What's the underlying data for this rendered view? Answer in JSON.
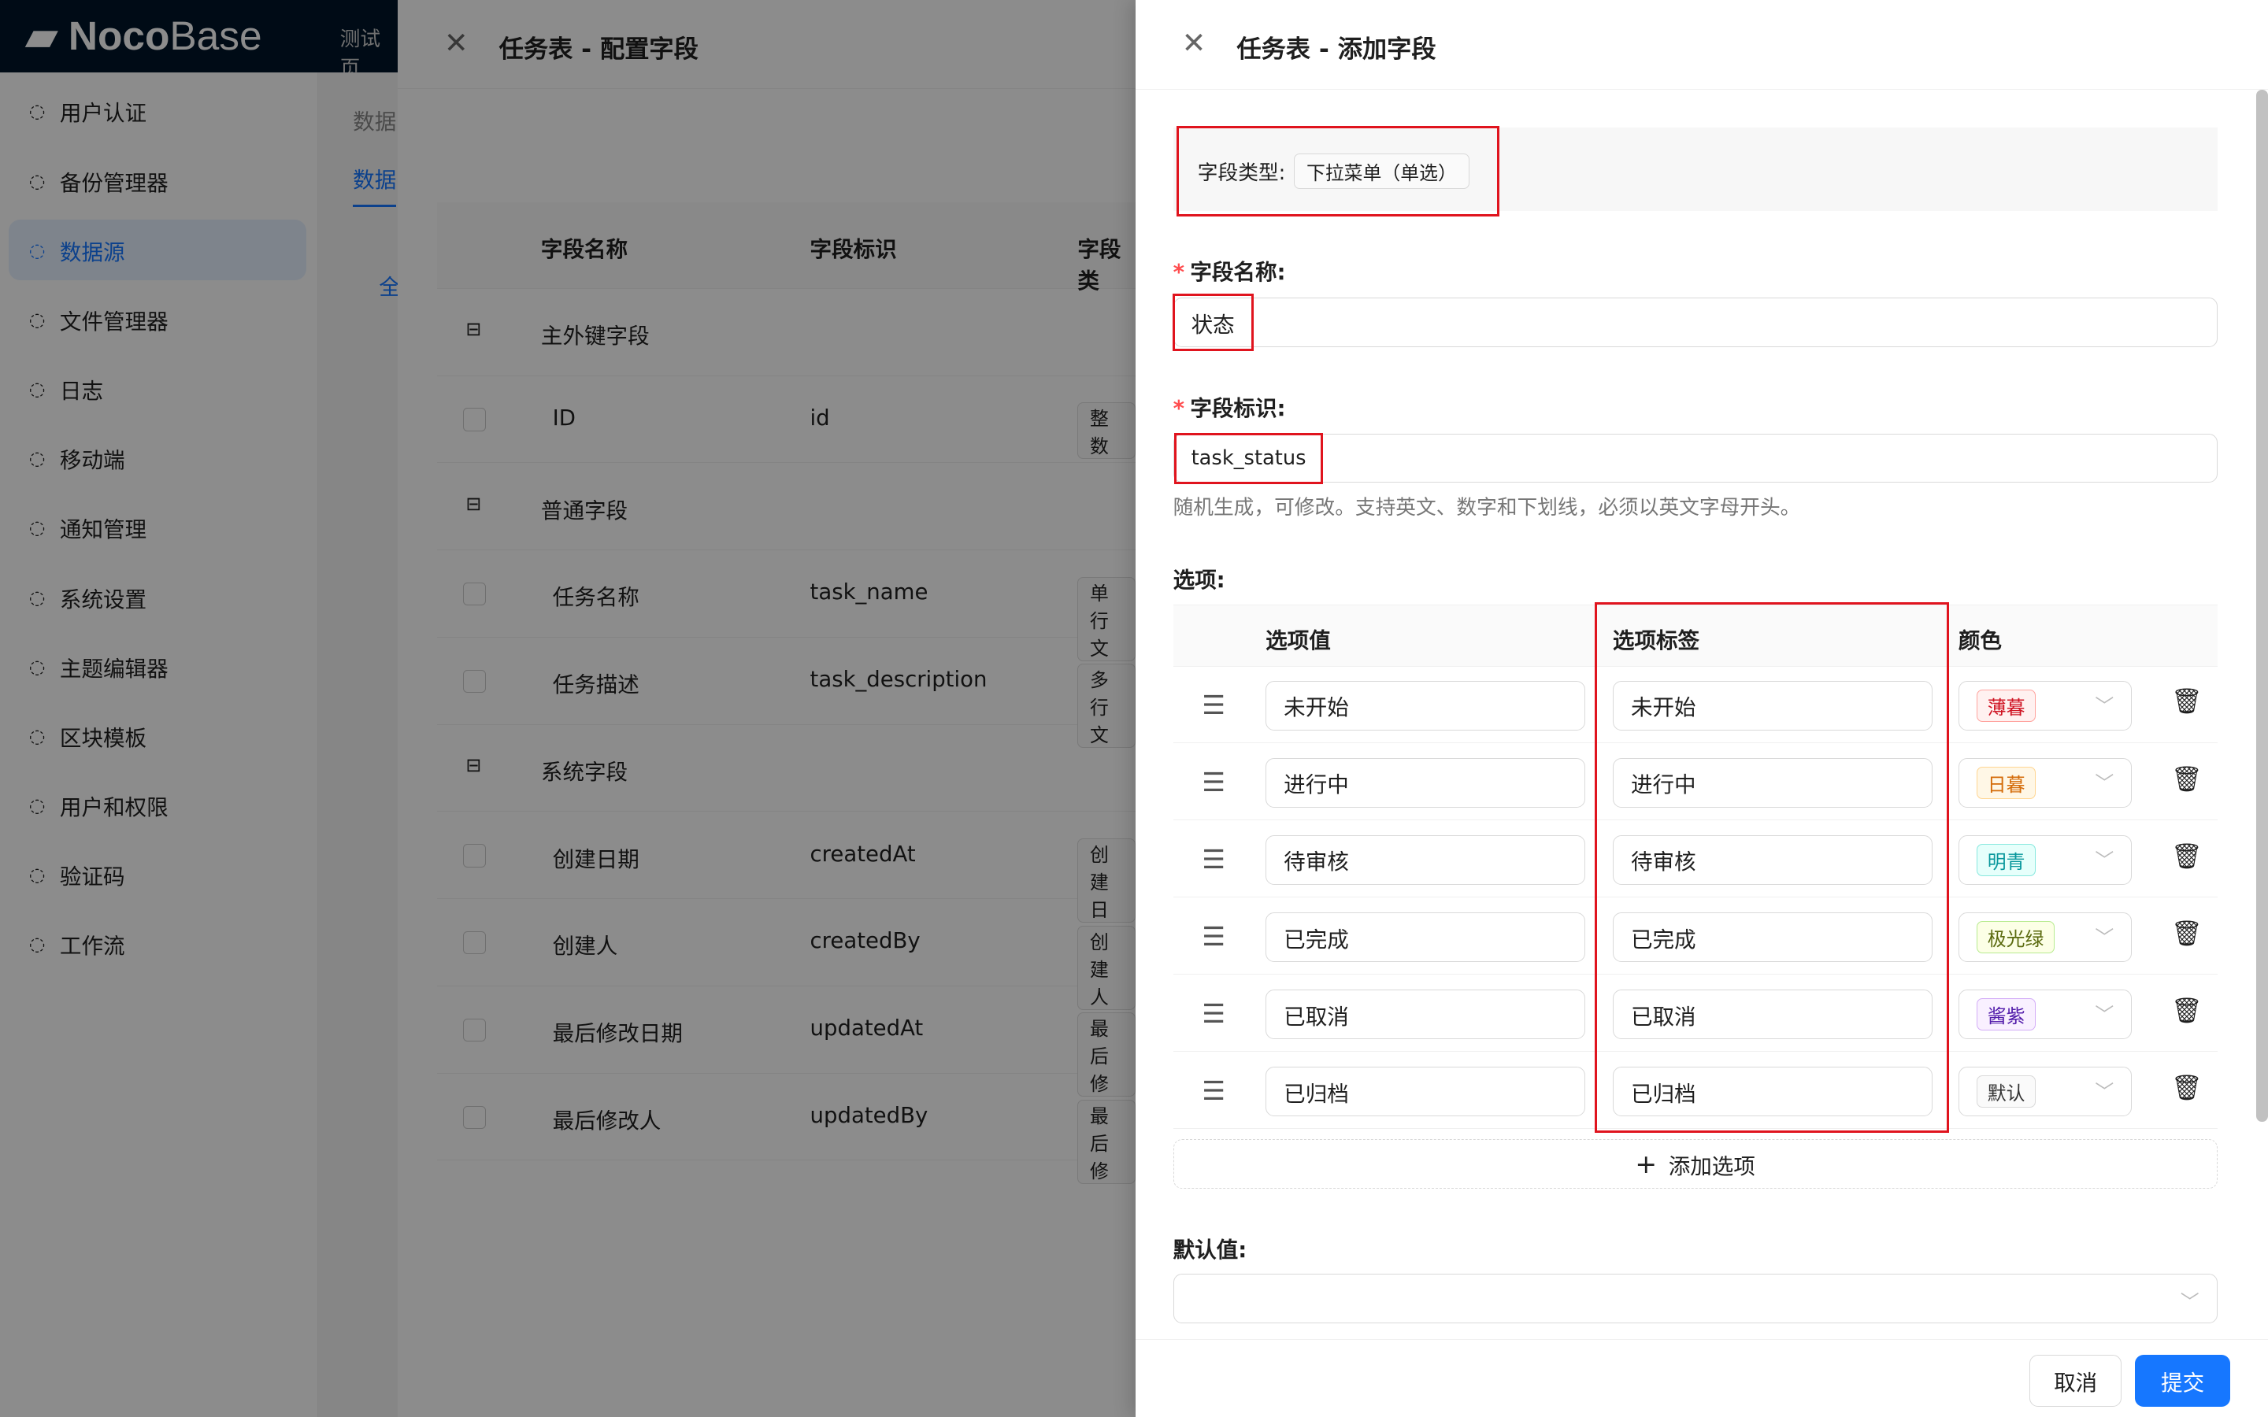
{
  "app": {
    "logo": "NocoBase",
    "top_tab": "测试页"
  },
  "sidebar": {
    "items": [
      {
        "label": "用户认证",
        "icon": "login-icon"
      },
      {
        "label": "备份管理器",
        "icon": "backup-icon"
      },
      {
        "label": "数据源",
        "icon": "database-icon",
        "active": true
      },
      {
        "label": "文件管理器",
        "icon": "file-icon"
      },
      {
        "label": "日志",
        "icon": "log-icon"
      },
      {
        "label": "移动端",
        "icon": "mobile-icon"
      },
      {
        "label": "通知管理",
        "icon": "notification-icon"
      },
      {
        "label": "系统设置",
        "icon": "gear-icon"
      },
      {
        "label": "主题编辑器",
        "icon": "theme-icon"
      },
      {
        "label": "区块模板",
        "icon": "template-icon"
      },
      {
        "label": "用户和权限",
        "icon": "user-icon"
      },
      {
        "label": "验证码",
        "icon": "captcha-icon"
      },
      {
        "label": "工作流",
        "icon": "workflow-icon"
      }
    ]
  },
  "bg_page": {
    "label1": "数据",
    "tab": "数据",
    "btn": "全"
  },
  "config_drawer": {
    "title": "任务表 - 配置字段",
    "headers": [
      "字段名称",
      "字段标识",
      "字段类"
    ],
    "rows": [
      {
        "group": true,
        "name": "主外键字段"
      },
      {
        "name": "ID",
        "key": "id",
        "type": "整数"
      },
      {
        "group": true,
        "name": "普通字段"
      },
      {
        "name": "任务名称",
        "key": "task_name",
        "type": "单行文"
      },
      {
        "name": "任务描述",
        "key": "task_description",
        "type": "多行文"
      },
      {
        "group": true,
        "name": "系统字段"
      },
      {
        "name": "创建日期",
        "key": "createdAt",
        "type": "创建日"
      },
      {
        "name": "创建人",
        "key": "createdBy",
        "type": "创建人"
      },
      {
        "name": "最后修改日期",
        "key": "updatedAt",
        "type": "最后修"
      },
      {
        "name": "最后修改人",
        "key": "updatedBy",
        "type": "最后修"
      }
    ]
  },
  "add_drawer": {
    "title": "任务表 - 添加字段",
    "field_type_label": "字段类型:",
    "field_type": "下拉菜单（单选）",
    "name_label": "字段名称:",
    "name_value": "状态",
    "key_label": "字段标识:",
    "key_value": "task_status",
    "key_hint": "随机生成，可修改。支持英文、数字和下划线，必须以英文字母开头。",
    "options_label": "选项:",
    "headers": {
      "value": "选项值",
      "label": "选项标签",
      "color": "颜色"
    },
    "options": [
      {
        "value": "未开始",
        "label": "未开始",
        "color": "薄暮",
        "fg": "#cf1322",
        "bg": "#fff1f0",
        "bd": "#ffa39e"
      },
      {
        "value": "进行中",
        "label": "进行中",
        "color": "日暮",
        "fg": "#d46b08",
        "bg": "#fff7e6",
        "bd": "#ffd591"
      },
      {
        "value": "待审核",
        "label": "待审核",
        "color": "明青",
        "fg": "#08979c",
        "bg": "#e6fffb",
        "bd": "#87e8de"
      },
      {
        "value": "已完成",
        "label": "已完成",
        "color": "极光绿",
        "fg": "#5b6b10",
        "bg": "#fcffe6",
        "bd": "#b7eb8f"
      },
      {
        "value": "已取消",
        "label": "已取消",
        "color": "酱紫",
        "fg": "#531dab",
        "bg": "#f9f0ff",
        "bd": "#d3adf7"
      },
      {
        "value": "已归档",
        "label": "已归档",
        "color": "默认",
        "fg": "#333333",
        "bg": "#fafafa",
        "bd": "#d9d9d9"
      }
    ],
    "add_option": "添加选项",
    "default_label": "默认值:",
    "cancel": "取消",
    "submit": "提交",
    "accent": "#1677ff"
  }
}
